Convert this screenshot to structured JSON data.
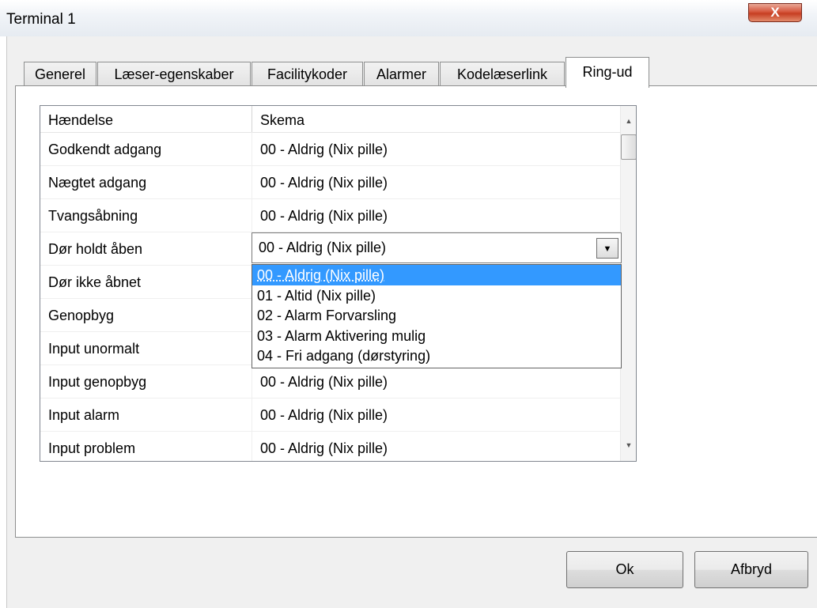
{
  "window": {
    "title": "Terminal 1",
    "close_label": "X"
  },
  "tabs": [
    {
      "label": "Generel"
    },
    {
      "label": "Læser-egenskaber"
    },
    {
      "label": "Facilitykoder"
    },
    {
      "label": "Alarmer"
    },
    {
      "label": "Kodelæserlink"
    },
    {
      "label": "Ring-ud",
      "active": true
    }
  ],
  "grid": {
    "columns": [
      "Hændelse",
      "Skema"
    ],
    "rows": [
      {
        "event": "Godkendt adgang",
        "schedule": "00 - Aldrig (Nix pille)"
      },
      {
        "event": "Nægtet adgang",
        "schedule": "00 - Aldrig (Nix pille)"
      },
      {
        "event": "Tvangsåbning",
        "schedule": "00 - Aldrig (Nix pille)"
      },
      {
        "event": "Dør holdt åben",
        "schedule": "00 - Aldrig (Nix pille)"
      },
      {
        "event": "Dør ikke åbnet",
        "schedule": ""
      },
      {
        "event": "Genopbyg",
        "schedule": ""
      },
      {
        "event": "Input unormalt",
        "schedule": ""
      },
      {
        "event": "Input genopbyg",
        "schedule": "00 - Aldrig (Nix pille)"
      },
      {
        "event": "Input alarm",
        "schedule": "00 - Aldrig (Nix pille)"
      },
      {
        "event": "Input problem",
        "schedule": "00 - Aldrig (Nix pille)"
      }
    ]
  },
  "combo": {
    "value": "00 - Aldrig (Nix pille)",
    "options": [
      "00 - Aldrig (Nix pille)",
      "01 - Altid (Nix pille)",
      "02 - Alarm Forvarsling",
      "03 - Alarm Aktivering mulig",
      "04 - Fri adgang (dørstyring)"
    ],
    "selected_index": 0
  },
  "buttons": {
    "ok": "Ok",
    "cancel": "Afbryd"
  }
}
